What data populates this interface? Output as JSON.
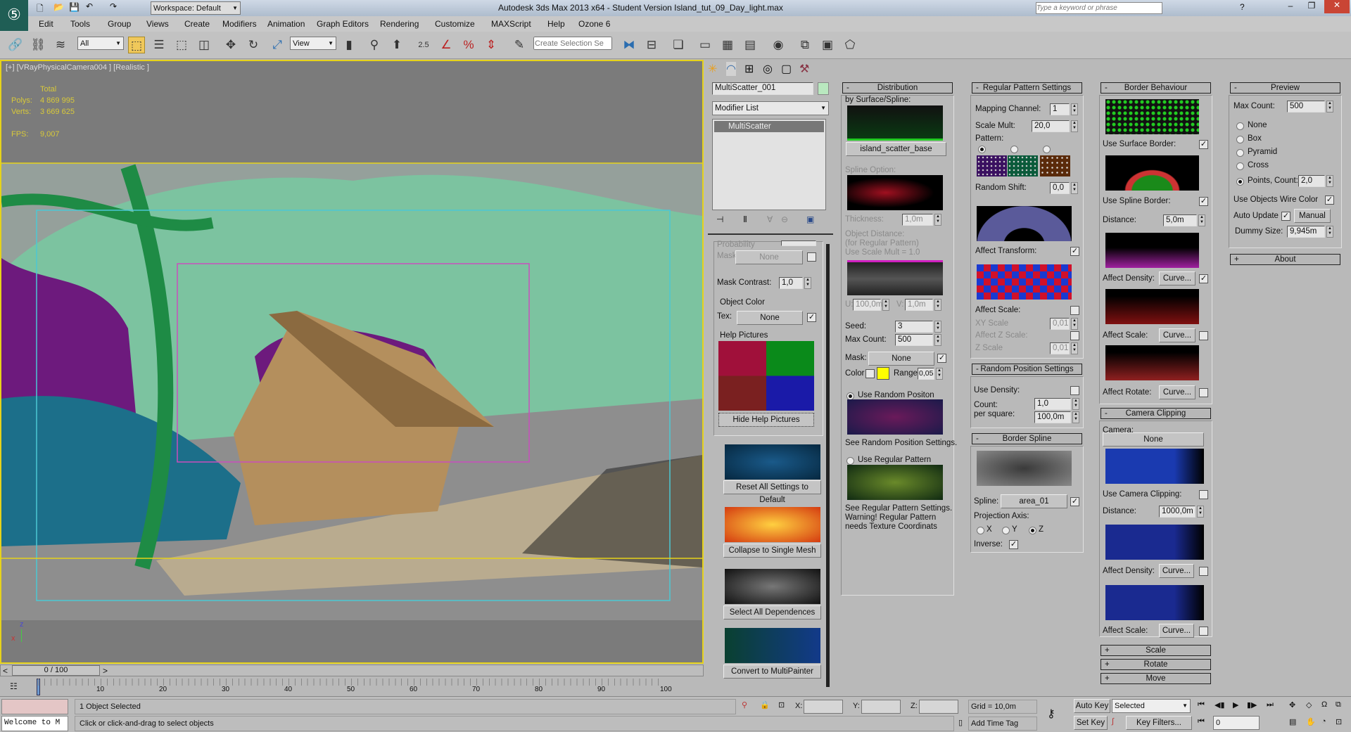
{
  "titlebar": {
    "workspace": "Workspace: Default",
    "title": "Autodesk 3ds Max  2013 x64  - Student Version    Island_tut_09_Day_light.max",
    "search_placeholder": "Type a keyword or phrase"
  },
  "menu": [
    "Edit",
    "Tools",
    "Group",
    "Views",
    "Create",
    "Modifiers",
    "Animation",
    "Graph Editors",
    "Rendering",
    "Customize",
    "MAXScript",
    "Help",
    "Ozone 6"
  ],
  "toolbar": {
    "filter": "All",
    "ref_coord": "View",
    "snap_angle": "2.5",
    "selection_set_placeholder": "Create Selection Se"
  },
  "viewport": {
    "label": "[+] [VRayPhysicalCamera004 ] [Realistic ]",
    "stats": {
      "total": "Total",
      "polys_label": "Polys:",
      "polys": "4 869 995",
      "verts_label": "Verts:",
      "verts": "3 669 625",
      "fps_label": "FPS:",
      "fps": "9,007"
    },
    "axis_z": "z",
    "axis_x": "x"
  },
  "timeline": {
    "frame": "0 / 100",
    "prev": "<",
    "next": ">",
    "ticks": [
      "10",
      "20",
      "30",
      "40",
      "50",
      "60",
      "70",
      "80",
      "90",
      "100"
    ]
  },
  "command_panel": {
    "object_name": "MultiScatter_001",
    "object_color": "#b9e8bf",
    "modifier_list": "Modifier List",
    "stack_item": "MultiScatter",
    "left": {
      "probability": "Probability",
      "mask_label": "Mask:",
      "mask_value": "None",
      "mask_contrast_label": "Mask Contrast:",
      "mask_contrast": "1,0",
      "object_color_group": "Object Color",
      "tex_label": "Tex:",
      "tex_value": "None",
      "help_pictures_group": "Help Pictures",
      "hide_help": "Hide Help Pictures",
      "reset": "Reset All Settings to Default",
      "collapse": "Collapse to Single Mesh",
      "select_deps": "Select All Dependences",
      "convert": "Convert to MultiPainter"
    },
    "distribution": {
      "title": "Distribution",
      "by_surface": "by Surface/Spline:",
      "surface_button": "island_scatter_base",
      "spline_option": "Spline Option:",
      "thickness_label": "Thickness:",
      "thickness": "1,0m",
      "obj_dist_1": "Object Distance:",
      "obj_dist_2": "(for Regular Pattern)",
      "obj_dist_3": "Use Scale Mult = 1.0",
      "u_label": "U:",
      "u": "100,0m",
      "v_label": "V:",
      "v": "1,0m",
      "seed_label": "Seed:",
      "seed": "3",
      "max_count_label": "Max Count:",
      "max_count": "500",
      "mask_label": "Mask:",
      "mask_value": "None",
      "color_label": "Color",
      "color_swatch": "#ffff00",
      "range_label": "Range",
      "range": "0,05",
      "random_pos": "Use Random Positon",
      "see_random": "See Random Position Settings.",
      "regular_pattern": "Use Regular Pattern",
      "see_regular_1": "See Regular Pattern Settings.",
      "see_regular_2": "Warning! Regular Pattern",
      "see_regular_3": "needs Texture Coordinats"
    },
    "regular_pattern": {
      "title": "Regular Pattern Settings",
      "mapping_label": "Mapping Channel:",
      "mapping": "1",
      "scale_mult_label": "Scale Mult:",
      "scale_mult": "20,0",
      "pattern_label": "Pattern:",
      "random_shift_label": "Random Shift:",
      "random_shift": "0,0",
      "affect_transform": "Affect Transform:",
      "affect_scale": "Affect Scale:",
      "xy_scale_label": "XY Scale",
      "xy_scale": "0,01",
      "affect_z": "Affect Z Scale:",
      "z_scale_label": "Z Scale",
      "z_scale": "0,01"
    },
    "random_position": {
      "title": "Random Position Settings",
      "use_density": "Use Density:",
      "count_label": "Count:",
      "count": "1,0",
      "per_square_label": "per square:",
      "per_square": "100,0m"
    },
    "border_spline": {
      "title": "Border Spline",
      "spline_label": "Spline:",
      "spline": "area_01",
      "projection": "Projection Axis:",
      "x": "X",
      "y": "Y",
      "z": "Z",
      "inverse": "Inverse:"
    },
    "border_behaviour": {
      "title": "Border Behaviour",
      "surface_border": "Use Surface Border:",
      "spline_border": "Use Spline Border:",
      "distance_label": "Distance:",
      "distance": "5,0m",
      "affect_density": "Affect Density:",
      "affect_scale": "Affect Scale:",
      "affect_rotate": "Affect Rotate:",
      "curve": "Curve..."
    },
    "camera_clipping": {
      "title": "Camera Clipping",
      "camera_label": "Camera:",
      "camera": "None",
      "use_clipping": "Use Camera Clipping:",
      "distance_label": "Distance:",
      "distance": "1000,0m",
      "affect_density": "Affect Density:",
      "affect_scale": "Affect Scale:",
      "curve": "Curve..."
    },
    "collapsed": [
      "Scale",
      "Rotate",
      "Move"
    ],
    "preview": {
      "title": "Preview",
      "max_count_label": "Max Count:",
      "max_count": "500",
      "none": "None",
      "box": "Box",
      "pyramid": "Pyramid",
      "cross": "Cross",
      "points": "Points,",
      "count_label": "Count:",
      "count": "2,0",
      "wire_color": "Use Objects Wire Color",
      "auto_update": "Auto Update",
      "manual": "Manual",
      "dummy_label": "Dummy Size:",
      "dummy": "9,945m"
    },
    "about": "About"
  },
  "status": {
    "welcome": "Welcome to M",
    "selected": "1 Object Selected",
    "hint": "Click or click-and-drag to select objects",
    "x": "X:",
    "y": "Y:",
    "z": "Z:",
    "grid": "Grid = 10,0m",
    "add_time_tag": "Add Time Tag",
    "auto_key": "Auto Key",
    "selected_dd": "Selected",
    "set_key": "Set Key",
    "key_filters": "Key Filters...",
    "frame": "0"
  }
}
